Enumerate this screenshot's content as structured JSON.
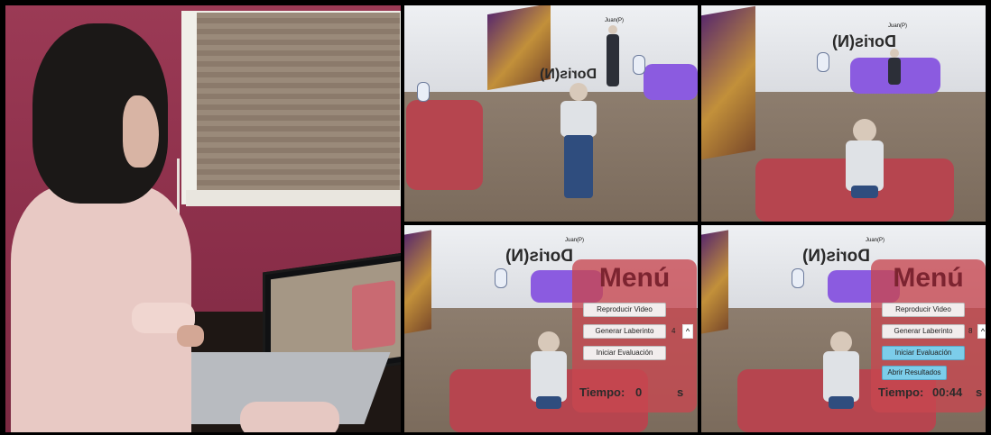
{
  "labels": {
    "top_left_name": "Doris(N)",
    "top_left_tag": "Juan(P)",
    "top_right_name": "Doris(N)",
    "top_right_tag": "Juan(P)",
    "bottom_left_name": "Doris(N)",
    "bottom_left_tag": "Juan(P)",
    "bottom_right_name": "Doris(N)",
    "bottom_right_tag": "Juan(P)"
  },
  "menu_left": {
    "title": "Menú",
    "btn_video": "Reproducir Video",
    "btn_maze": "Generar Laberinto",
    "maze_value": "4",
    "caret": "^",
    "btn_eval": "Iniciar Evaluación",
    "time_label": "Tiempo:",
    "time_value": "0",
    "unit": "s"
  },
  "menu_right": {
    "title": "Menú",
    "btn_video": "Reproducir Video",
    "btn_maze": "Generar Laberinto",
    "maze_value": "8",
    "caret": "^",
    "btn_eval": "Iniciar Evaluación",
    "btn_results": "Abrir Resultados",
    "time_label": "Tiempo:",
    "time_value": "00:44",
    "unit": "s"
  },
  "colors": {
    "menu_overlay": "#c84650",
    "menu_title": "#7c2430",
    "eval_active": "#7ccdea",
    "sofa_purple": "#8b5be0",
    "sofa_red": "#b6454f"
  }
}
